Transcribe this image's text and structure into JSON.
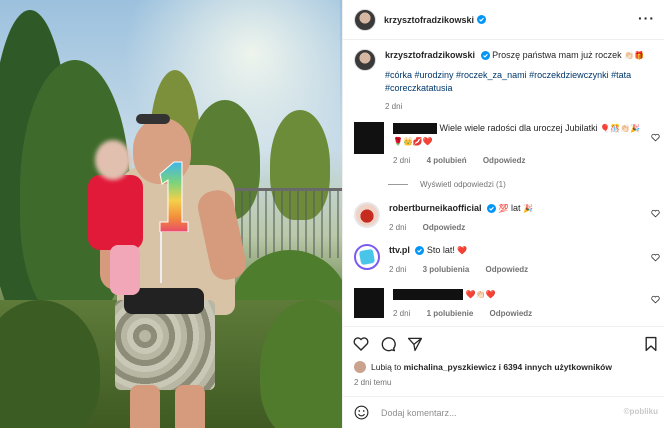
{
  "post": {
    "author": "krzysztofradzikowski",
    "caption_text": "Proszę państwa mam już roczek",
    "caption_emojis": "👏🏻🎁",
    "hashtags": "#córka #urodziny #roczek_za_nami #roczekdziewczynki #tata #coreczkatatusia",
    "age": "2 dni"
  },
  "comments": [
    {
      "author_redacted": true,
      "text": "Wiele wiele radości dla uroczej Jubilatki",
      "emojis_inline": "🎈🎊👏🏻🎉",
      "emojis_line2": "🌹👑💋❤️",
      "age": "2 dni",
      "likes": "4 polubień",
      "reply": "Odpowiedz"
    },
    {
      "author": "robertburneikaofficial",
      "text": "lat",
      "emojis_before": "💯",
      "emojis_after": "🎉",
      "age": "2 dni",
      "reply": "Odpowiedz"
    },
    {
      "author": "ttv.pl",
      "text": "Sto lat!",
      "emojis_after": "❤️",
      "age": "2 dni",
      "likes": "3 polubienia",
      "reply": "Odpowiedz"
    },
    {
      "author_redacted": true,
      "emojis_after": "❤️👏🏻❤️",
      "age": "2 dni",
      "likes": "1 polubienie",
      "reply": "Odpowiedz"
    }
  ],
  "view_replies": "Wyświetl odpowiedzi (1)",
  "likes_summary": {
    "prefix": "Lubią to",
    "user": "michalina_pyszkiewicz",
    "rest": "i 6394 innych użytkowników"
  },
  "time_ago": "2 dni temu",
  "composer": {
    "placeholder": "Dodaj komentarz..."
  },
  "watermark": "©pobliku",
  "icons": {
    "more": "more-dots-icon",
    "verified": "verified-badge-icon",
    "like": "heart-icon",
    "comment": "comment-bubble-icon",
    "share": "send-icon",
    "save": "bookmark-icon",
    "emoji": "smiley-icon"
  },
  "colors": {
    "link": "#00376b",
    "verified": "#0095f6",
    "muted": "#737373"
  }
}
